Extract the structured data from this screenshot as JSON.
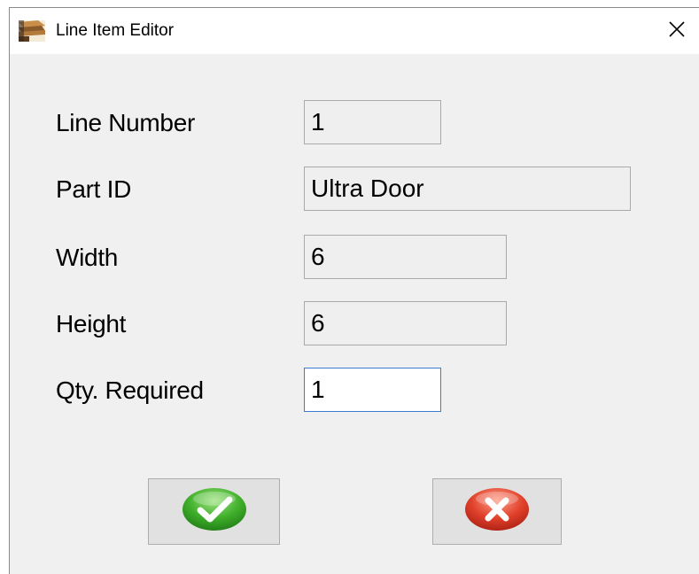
{
  "window": {
    "title": "Line Item Editor",
    "app_icon": "wood-plank-icon",
    "close_icon": "close-icon"
  },
  "form": {
    "line_number": {
      "label": "Line Number",
      "value": "1"
    },
    "part_id": {
      "label": "Part ID",
      "value": "Ultra Door"
    },
    "width": {
      "label": "Width",
      "value": "6"
    },
    "height": {
      "label": "Height",
      "value": "6"
    },
    "qty_required": {
      "label": "Qty. Required",
      "value": "1"
    }
  },
  "buttons": {
    "ok_icon": "green-checkmark-icon",
    "cancel_icon": "red-x-icon"
  },
  "colors": {
    "ok_green": "#3fae2a",
    "cancel_red": "#e0402a",
    "focus_border": "#3b7dd1"
  }
}
